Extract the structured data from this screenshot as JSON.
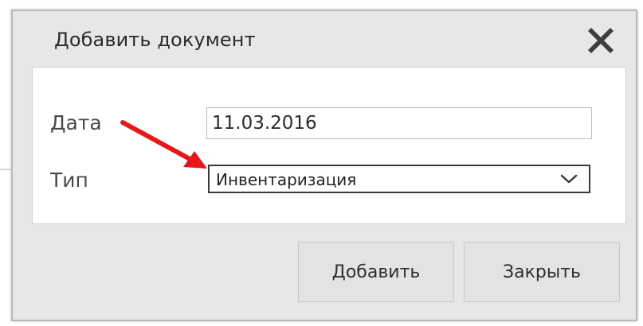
{
  "dialog": {
    "title": "Добавить документ",
    "close_icon": "close-x-icon"
  },
  "form": {
    "date_label": "Дата",
    "date_value": "11.03.2016",
    "type_label": "Тип",
    "type_value": "Инвентаризация",
    "type_dropdown_icon": "chevron-down-icon"
  },
  "buttons": {
    "add_label": "Добавить",
    "close_label": "Закрыть"
  },
  "annotation": {
    "arrow_icon": "red-arrow-icon",
    "arrow_color": "#e8161b"
  }
}
